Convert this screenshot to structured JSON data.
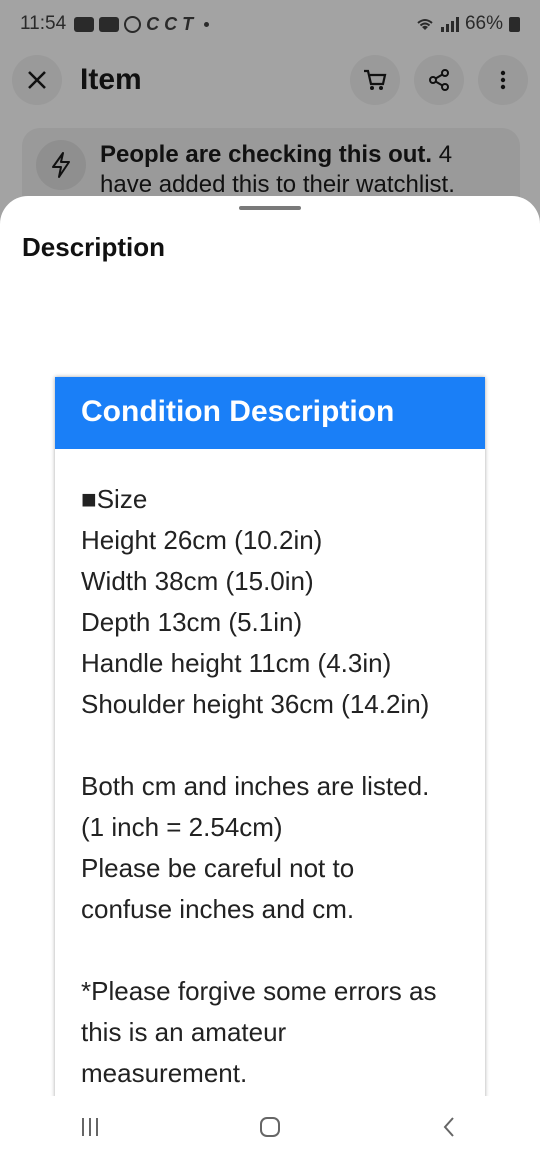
{
  "status": {
    "time": "11:54",
    "carrier_glyph": "T",
    "battery": "66%"
  },
  "appbar": {
    "title": "Item"
  },
  "banner": {
    "headline": "People are checking this out.",
    "detail": "4 have added this to their watchlist."
  },
  "sheet": {
    "title": "Description"
  },
  "condition": {
    "header": "Condition Description",
    "lines": [
      "■Size",
      "Height 26cm (10.2in)",
      "Width 38cm (15.0in)",
      "Depth 13cm (5.1in)",
      "Handle height 11cm (4.3in)",
      "Shoulder height 36cm (14.2in)",
      "",
      "Both cm and inches are listed.",
      "(1 inch = 2.54cm)",
      "Please be careful not to",
      "confuse inches and cm.",
      "",
      "*Please forgive some errors as",
      "this is an amateur",
      "measurement."
    ]
  },
  "colors": {
    "accent": "#1a7ff7",
    "dim_overlay": "#a3a3a3"
  }
}
